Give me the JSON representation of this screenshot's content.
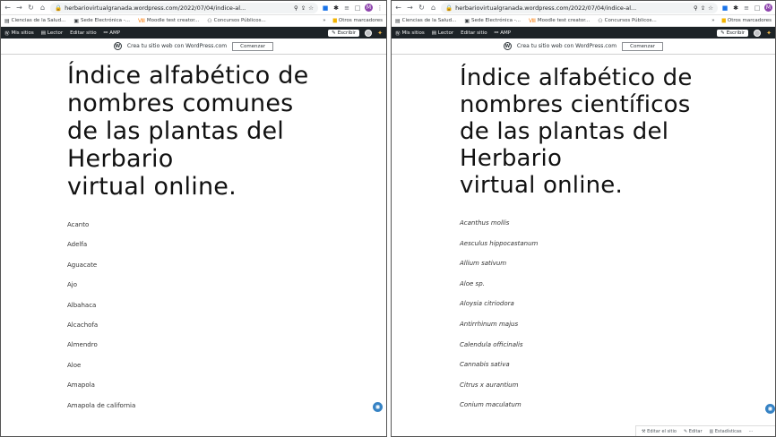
{
  "browser": {
    "url": "herbariovirtualgranada.wordpress.com/2022/07/04/indice-al...",
    "profile_initial": "M"
  },
  "bookmarks": {
    "items": [
      "Ciencias de la Salud...",
      "Sede Electrónica -...",
      "Moodle test creator...",
      "Concursos Públicos..."
    ],
    "overflow": "»",
    "others": "Otros marcadores"
  },
  "adminbar": {
    "my_sites": "Mis sitios",
    "reader": "Lector",
    "edit_site": "Editar sitio",
    "amp": "AMP",
    "write": "Escribir"
  },
  "promo": {
    "text": "Crea tu sitio web con WordPress.com",
    "button": "Comenzar"
  },
  "left": {
    "title_lines": [
      "Índice alfabético de",
      "nombres comunes",
      "de las plantas del",
      "Herbario",
      "virtual online."
    ],
    "items": [
      "Acanto",
      "Adelfa",
      "Aguacate",
      "Ajo",
      "Albahaca",
      "Alcachofa",
      "Almendro",
      "Aloe",
      "Amapola",
      "Amapola de california"
    ]
  },
  "right": {
    "title_lines": [
      "Índice alfabético de",
      "nombres científicos",
      "de las plantas del",
      "Herbario",
      "virtual online."
    ],
    "items": [
      "Acanthus mollis",
      "Aesculus hippocastanum",
      "Allium sativum",
      "Aloe sp.",
      "Aloysia citriodora",
      "Antirrhinum majus",
      "Calendula officinalis",
      "Cannabis sativa",
      "Citrus x aurantium",
      "Conium maculatum"
    ]
  },
  "editbar": {
    "edit_site": "Editar el sitio",
    "edit": "Editar",
    "stats": "Estadísticas",
    "more": "···"
  },
  "colors": {
    "adminbar": "#1d2327",
    "fab": "#3582c4"
  }
}
